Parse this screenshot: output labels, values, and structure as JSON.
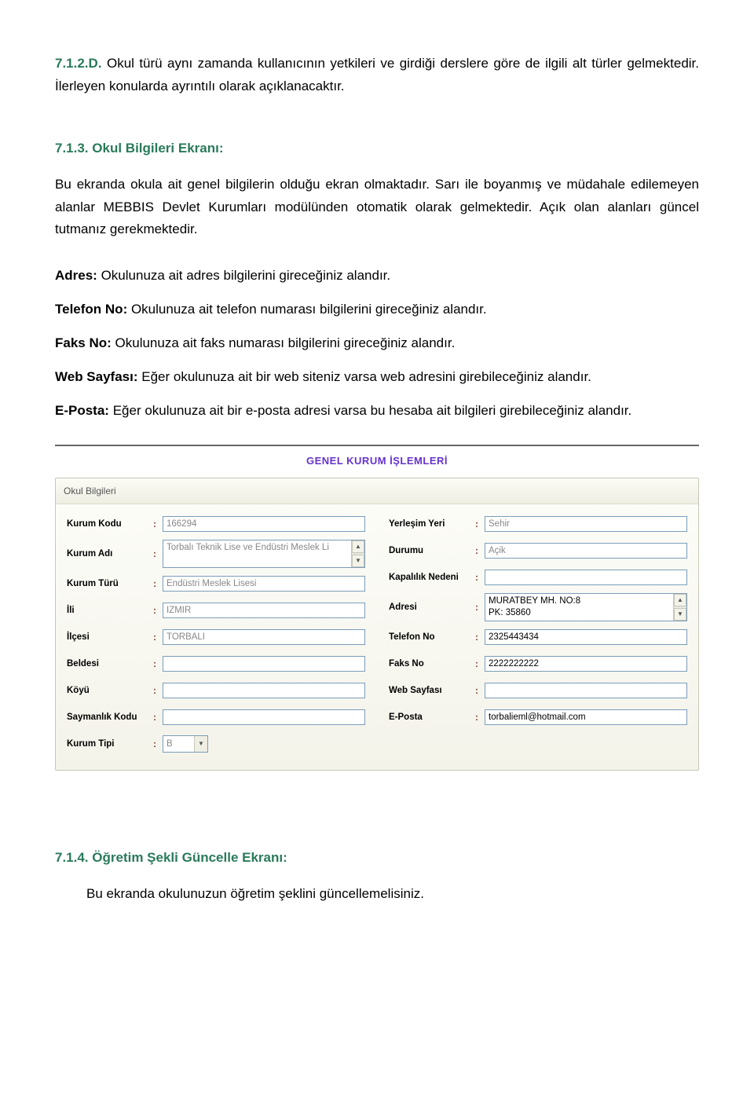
{
  "sec712d": {
    "num": "7.1.2.D.",
    "text": "Okul türü aynı zamanda kullanıcının yetkileri ve girdiği derslere göre de ilgili alt türler gelmektedir. İlerleyen konularda ayrıntılı olarak açıklanacaktır."
  },
  "sec713": {
    "num": "7.1.3.",
    "title": "Okul Bilgileri Ekranı:",
    "p1": "Bu ekranda okula ait genel bilgilerin olduğu ekran olmaktadır. Sarı ile boyanmış ve müdahale edilemeyen alanlar MEBBIS Devlet Kurumları modülünden otomatik olarak gelmektedir. Açık olan alanları güncel tutmanız gerekmektedir."
  },
  "defs": {
    "adres_label": "Adres:",
    "adres_text": " Okulunuza ait adres bilgilerini gireceğiniz alandır.",
    "tel_label": "Telefon No:",
    "tel_text": " Okulunuza ait telefon numarası bilgilerini gireceğiniz alandır.",
    "faks_label": "Faks No:",
    "faks_text": " Okulunuza ait faks numarası bilgilerini gireceğiniz alandır.",
    "web_label": "Web Sayfası:",
    "web_text": " Eğer okulunuza ait bir web siteniz varsa web adresini girebileceğiniz alandır.",
    "eposta_label": "E-Posta:",
    "eposta_text": " Eğer okulunuza ait bir e-posta adresi varsa bu hesaba ait bilgileri girebileceğiniz alandır."
  },
  "form": {
    "app_title": "GENEL KURUM İŞLEMLERİ",
    "panel_title": "Okul Bilgileri",
    "left": {
      "kurum_kodu_l": "Kurum Kodu",
      "kurum_kodu_v": "166294",
      "kurum_adi_l": "Kurum Adı",
      "kurum_adi_v": "Torbalı Teknik Lise ve Endüstri Meslek Li",
      "kurum_turu_l": "Kurum Türü",
      "kurum_turu_v": "Endüstri Meslek Lisesi",
      "ili_l": "İli",
      "ili_v": "IZMIR",
      "ilcesi_l": "İlçesi",
      "ilcesi_v": "TORBALI",
      "beldesi_l": "Beldesi",
      "beldesi_v": "",
      "koyu_l": "Köyü",
      "koyu_v": "",
      "saymanlik_l": "Saymanlık Kodu",
      "saymanlik_v": "",
      "kurum_tipi_l": "Kurum Tipi",
      "kurum_tipi_v": "B"
    },
    "right": {
      "yerlesim_l": "Yerleşim Yeri",
      "yerlesim_v": "Sehir",
      "durumu_l": "Durumu",
      "durumu_v": "Açik",
      "kapalilik_l": "Kapalılık Nedeni",
      "kapalilik_v": "",
      "adresi_l": "Adresi",
      "adresi_v": "MURATBEY MH. NO:8\nPK: 35860",
      "tel_l": "Telefon No",
      "tel_v": "2325443434",
      "faks_l": "Faks No",
      "faks_v": "2222222222",
      "web_l": "Web Sayfası",
      "web_v": "",
      "eposta_l": "E-Posta",
      "eposta_v": "torbalieml@hotmail.com"
    }
  },
  "sec714": {
    "num": "7.1.4.",
    "title": "Öğretim Şekli Güncelle Ekranı:",
    "p1": "Bu ekranda okulunuzun öğretim şeklini güncellemelisiniz."
  }
}
